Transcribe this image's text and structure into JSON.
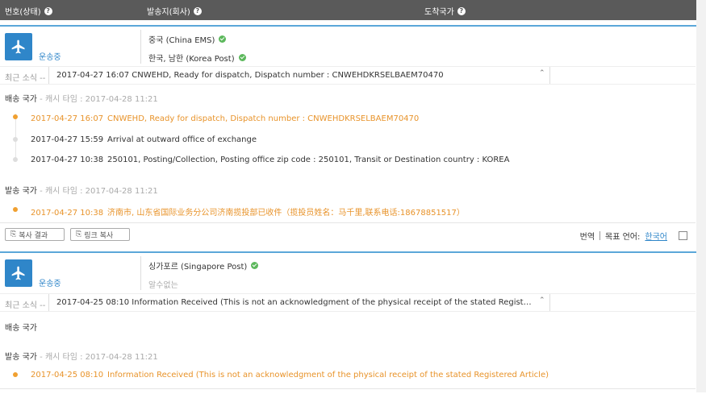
{
  "header": {
    "col1": "번호(상태)",
    "col2": "발송지(회사)",
    "col3": "도착국가"
  },
  "cards": [
    {
      "status": "운송중",
      "origin_carrier": "중국 (China EMS)",
      "dest_carrier": "한국, 남한 (Korea Post)",
      "latest_label": "최근 소식 --",
      "latest_text": "2017-04-27 16:07 CNWEHD, Ready for dispatch, Dispatch number : CNWEHDKRSELBAEM70470",
      "dest_section": "배송 국가",
      "dest_cache": "- 캐시 타임 : 2017-04-28 11:21",
      "dest_events": [
        {
          "date": "2017-04-27 16:07",
          "text": "CNWEHD, Ready for dispatch, Dispatch number : CNWEHDKRSELBAEM70470"
        },
        {
          "date": "2017-04-27 15:59",
          "text": "Arrival at outward office of exchange"
        },
        {
          "date": "2017-04-27 10:38",
          "text": "250101, Posting/Collection, Posting office zip code : 250101, Transit or Destination country : KOREA"
        }
      ],
      "origin_section": "발송 국가",
      "origin_cache": "- 캐시 타임 : 2017-04-28 11:21",
      "origin_events": [
        {
          "date": "2017-04-27 10:38",
          "text": "济南市, 山东省国际业务分公司济南揽投部已收件（揽投员姓名：马千里,联系电话:18678851517）"
        }
      ]
    },
    {
      "status": "운송중",
      "origin_carrier": "싱가포르 (Singapore Post)",
      "dest_carrier": "알수없는",
      "latest_label": "최근 소식 --",
      "latest_text": "2017-04-25 08:10 Information Received (This is not an acknowledgment of the physical receipt of the stated Registered A...",
      "dest_section": "배송 국가",
      "origin_section": "발송 국가",
      "origin_cache": "- 캐시 타임 : 2017-04-28 11:21",
      "origin_events": [
        {
          "date": "2017-04-25 08:10",
          "text": "Information Received (This is not an acknowledgment of the physical receipt of the stated Registered Article)"
        }
      ]
    }
  ],
  "footer": {
    "copy_result": "복사 결과",
    "copy_link": "링크 복사",
    "translate": "번역",
    "target_lang_label": "목표 언어:",
    "target_lang": "한국어"
  },
  "colors": {
    "accent": "#2f86c9",
    "highlight": "#e8932a",
    "header_bg": "#5a5a5a",
    "ok": "#5cb85c"
  },
  "icons": [
    "help-icon",
    "airplane-icon",
    "check-circle-icon",
    "chevron-icon",
    "copy-icon"
  ]
}
